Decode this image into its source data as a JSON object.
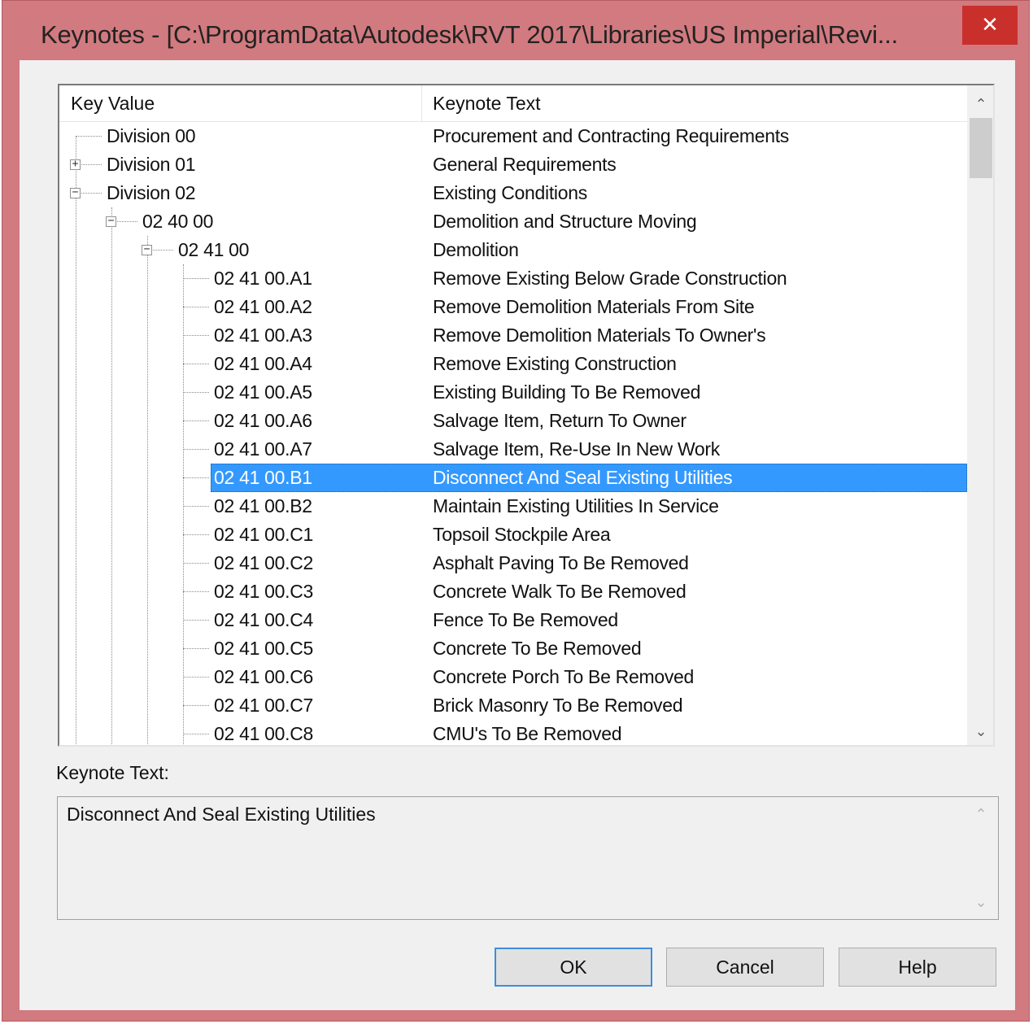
{
  "window": {
    "title": "Keynotes - [C:\\ProgramData\\Autodesk\\RVT 2017\\Libraries\\US Imperial\\Revi...",
    "close_glyph": "✕"
  },
  "tree": {
    "columns": {
      "key": "Key Value",
      "text": "Keynote Text"
    },
    "rows": [
      {
        "key": "Division 00",
        "text": "Procurement and Contracting Requirements"
      },
      {
        "key": "Division 01",
        "text": "General Requirements"
      },
      {
        "key": "Division 02",
        "text": "Existing Conditions"
      },
      {
        "key": "02 40 00",
        "text": "Demolition and Structure Moving"
      },
      {
        "key": "02 41 00",
        "text": "Demolition"
      },
      {
        "key": "02 41 00.A1",
        "text": "Remove Existing Below Grade Construction"
      },
      {
        "key": "02 41 00.A2",
        "text": "Remove Demolition Materials From Site"
      },
      {
        "key": "02 41 00.A3",
        "text": "Remove Demolition Materials To Owner's"
      },
      {
        "key": "02 41 00.A4",
        "text": "Remove Existing Construction"
      },
      {
        "key": "02 41 00.A5",
        "text": "Existing Building To Be Removed"
      },
      {
        "key": "02 41 00.A6",
        "text": "Salvage Item, Return To Owner"
      },
      {
        "key": "02 41 00.A7",
        "text": "Salvage Item, Re-Use In New Work"
      },
      {
        "key": "02 41 00.B1",
        "text": "Disconnect And Seal Existing Utilities"
      },
      {
        "key": "02 41 00.B2",
        "text": "Maintain Existing Utilities In Service"
      },
      {
        "key": "02 41 00.C1",
        "text": "Topsoil Stockpile Area"
      },
      {
        "key": "02 41 00.C2",
        "text": "Asphalt Paving To Be Removed"
      },
      {
        "key": "02 41 00.C3",
        "text": "Concrete Walk To Be Removed"
      },
      {
        "key": "02 41 00.C4",
        "text": "Fence To Be Removed"
      },
      {
        "key": "02 41 00.C5",
        "text": "Concrete To Be Removed"
      },
      {
        "key": "02 41 00.C6",
        "text": "Concrete Porch To Be Removed"
      },
      {
        "key": "02 41 00.C7",
        "text": "Brick Masonry To Be Removed"
      },
      {
        "key": "02 41 00.C8",
        "text": "CMU's To Be Removed"
      }
    ],
    "selected_key": "02 41 00.B1",
    "scroll_up_glyph": "⌃",
    "scroll_down_glyph": "⌄"
  },
  "details": {
    "label": "Keynote Text:",
    "value": "Disconnect And Seal Existing Utilities"
  },
  "buttons": {
    "ok": "OK",
    "cancel": "Cancel",
    "help": "Help"
  },
  "colors": {
    "selection": "#3399ff",
    "frame": "#d17a7f",
    "close": "#c9302c"
  },
  "icons": {
    "expand": "plus-box-icon",
    "collapse": "minus-box-icon"
  }
}
